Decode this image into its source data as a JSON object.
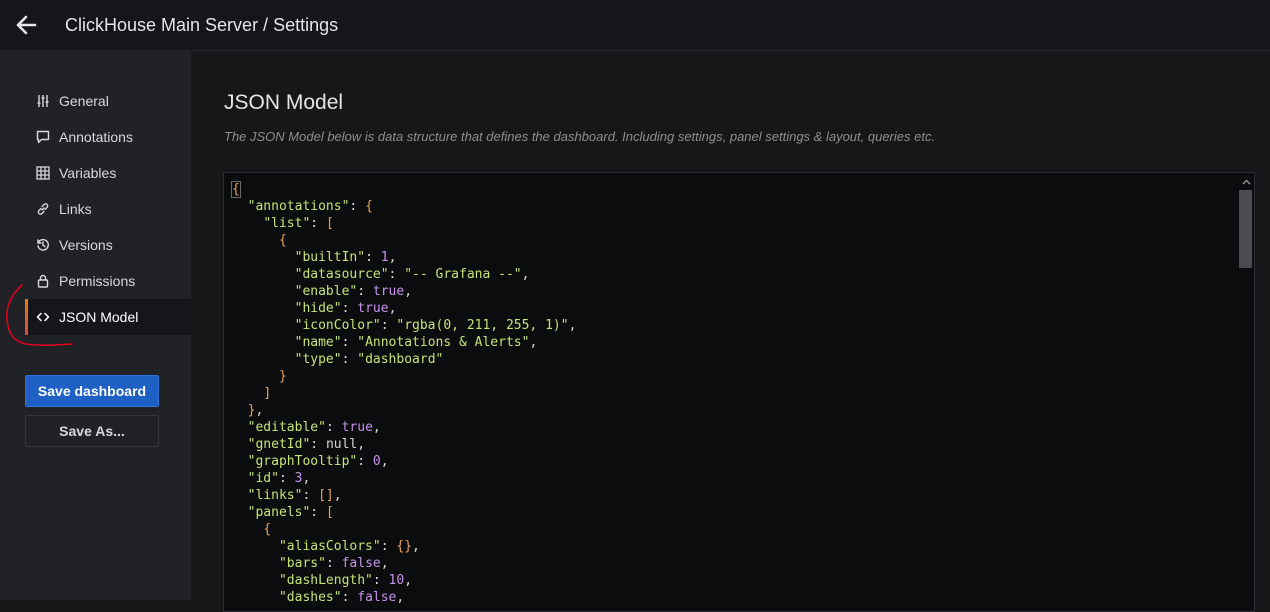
{
  "header": {
    "title": "ClickHouse Main Server / Settings",
    "back_icon": "arrow-left-icon"
  },
  "sidebar": {
    "items": [
      {
        "label": "General",
        "icon": "sliders-icon",
        "active": false
      },
      {
        "label": "Annotations",
        "icon": "comment-icon",
        "active": false
      },
      {
        "label": "Variables",
        "icon": "table-icon",
        "active": false
      },
      {
        "label": "Links",
        "icon": "link-icon",
        "active": false
      },
      {
        "label": "Versions",
        "icon": "history-icon",
        "active": false
      },
      {
        "label": "Permissions",
        "icon": "lock-icon",
        "active": false
      },
      {
        "label": "JSON Model",
        "icon": "code-icon",
        "active": true
      }
    ],
    "save_label": "Save dashboard",
    "save_as_label": "Save As..."
  },
  "main": {
    "title": "JSON Model",
    "description": "The JSON Model below is data structure that defines the dashboard. Including settings, panel settings & layout, queries etc."
  },
  "editor": {
    "lines": [
      {
        "indent": 0,
        "tokens": [
          {
            "t": "{",
            "c": "brk"
          }
        ]
      },
      {
        "indent": 1,
        "tokens": [
          {
            "t": "\"annotations\"",
            "c": "key"
          },
          {
            "t": ": ",
            "c": "pun"
          },
          {
            "t": "{",
            "c": "brk"
          }
        ]
      },
      {
        "indent": 2,
        "tokens": [
          {
            "t": "\"list\"",
            "c": "key"
          },
          {
            "t": ": ",
            "c": "pun"
          },
          {
            "t": "[",
            "c": "brk"
          }
        ]
      },
      {
        "indent": 3,
        "tokens": [
          {
            "t": "{",
            "c": "brk"
          }
        ]
      },
      {
        "indent": 4,
        "tokens": [
          {
            "t": "\"builtIn\"",
            "c": "key"
          },
          {
            "t": ": ",
            "c": "pun"
          },
          {
            "t": "1",
            "c": "num"
          },
          {
            "t": ",",
            "c": "pun"
          }
        ]
      },
      {
        "indent": 4,
        "tokens": [
          {
            "t": "\"datasource\"",
            "c": "key"
          },
          {
            "t": ": ",
            "c": "pun"
          },
          {
            "t": "\"-- Grafana --\"",
            "c": "str"
          },
          {
            "t": ",",
            "c": "pun"
          }
        ]
      },
      {
        "indent": 4,
        "tokens": [
          {
            "t": "\"enable\"",
            "c": "key"
          },
          {
            "t": ": ",
            "c": "pun"
          },
          {
            "t": "true",
            "c": "kw"
          },
          {
            "t": ",",
            "c": "pun"
          }
        ]
      },
      {
        "indent": 4,
        "tokens": [
          {
            "t": "\"hide\"",
            "c": "key"
          },
          {
            "t": ": ",
            "c": "pun"
          },
          {
            "t": "true",
            "c": "kw"
          },
          {
            "t": ",",
            "c": "pun"
          }
        ]
      },
      {
        "indent": 4,
        "tokens": [
          {
            "t": "\"iconColor\"",
            "c": "key"
          },
          {
            "t": ": ",
            "c": "pun"
          },
          {
            "t": "\"rgba(0, 211, 255, 1)\"",
            "c": "str"
          },
          {
            "t": ",",
            "c": "pun"
          }
        ]
      },
      {
        "indent": 4,
        "tokens": [
          {
            "t": "\"name\"",
            "c": "key"
          },
          {
            "t": ": ",
            "c": "pun"
          },
          {
            "t": "\"Annotations & Alerts\"",
            "c": "str"
          },
          {
            "t": ",",
            "c": "pun"
          }
        ]
      },
      {
        "indent": 4,
        "tokens": [
          {
            "t": "\"type\"",
            "c": "key"
          },
          {
            "t": ": ",
            "c": "pun"
          },
          {
            "t": "\"dashboard\"",
            "c": "str"
          }
        ]
      },
      {
        "indent": 3,
        "tokens": [
          {
            "t": "}",
            "c": "brk"
          }
        ]
      },
      {
        "indent": 2,
        "tokens": [
          {
            "t": "]",
            "c": "brk"
          }
        ]
      },
      {
        "indent": 1,
        "tokens": [
          {
            "t": "}",
            "c": "brk"
          },
          {
            "t": ",",
            "c": "pun"
          }
        ]
      },
      {
        "indent": 1,
        "tokens": [
          {
            "t": "\"editable\"",
            "c": "key"
          },
          {
            "t": ": ",
            "c": "pun"
          },
          {
            "t": "true",
            "c": "kw"
          },
          {
            "t": ",",
            "c": "pun"
          }
        ]
      },
      {
        "indent": 1,
        "tokens": [
          {
            "t": "\"gnetId\"",
            "c": "key"
          },
          {
            "t": ": ",
            "c": "pun"
          },
          {
            "t": "null",
            "c": "null"
          },
          {
            "t": ",",
            "c": "pun"
          }
        ]
      },
      {
        "indent": 1,
        "tokens": [
          {
            "t": "\"graphTooltip\"",
            "c": "key"
          },
          {
            "t": ": ",
            "c": "pun"
          },
          {
            "t": "0",
            "c": "num"
          },
          {
            "t": ",",
            "c": "pun"
          }
        ]
      },
      {
        "indent": 1,
        "tokens": [
          {
            "t": "\"id\"",
            "c": "key"
          },
          {
            "t": ": ",
            "c": "pun"
          },
          {
            "t": "3",
            "c": "num"
          },
          {
            "t": ",",
            "c": "pun"
          }
        ]
      },
      {
        "indent": 1,
        "tokens": [
          {
            "t": "\"links\"",
            "c": "key"
          },
          {
            "t": ": ",
            "c": "pun"
          },
          {
            "t": "[]",
            "c": "brk"
          },
          {
            "t": ",",
            "c": "pun"
          }
        ]
      },
      {
        "indent": 1,
        "tokens": [
          {
            "t": "\"panels\"",
            "c": "key"
          },
          {
            "t": ": ",
            "c": "pun"
          },
          {
            "t": "[",
            "c": "brk"
          }
        ]
      },
      {
        "indent": 2,
        "tokens": [
          {
            "t": "{",
            "c": "brk"
          }
        ]
      },
      {
        "indent": 3,
        "tokens": [
          {
            "t": "\"aliasColors\"",
            "c": "key"
          },
          {
            "t": ": ",
            "c": "pun"
          },
          {
            "t": "{}",
            "c": "brk"
          },
          {
            "t": ",",
            "c": "pun"
          }
        ]
      },
      {
        "indent": 3,
        "tokens": [
          {
            "t": "\"bars\"",
            "c": "key"
          },
          {
            "t": ": ",
            "c": "pun"
          },
          {
            "t": "false",
            "c": "kw"
          },
          {
            "t": ",",
            "c": "pun"
          }
        ]
      },
      {
        "indent": 3,
        "tokens": [
          {
            "t": "\"dashLength\"",
            "c": "key"
          },
          {
            "t": ": ",
            "c": "pun"
          },
          {
            "t": "10",
            "c": "num"
          },
          {
            "t": ",",
            "c": "pun"
          }
        ]
      },
      {
        "indent": 3,
        "tokens": [
          {
            "t": "\"dashes\"",
            "c": "key"
          },
          {
            "t": ": ",
            "c": "pun"
          },
          {
            "t": "false",
            "c": "kw"
          },
          {
            "t": ",",
            "c": "pun"
          }
        ]
      }
    ]
  },
  "colors": {
    "accent": "#1f60c4",
    "active_bar": "#eb7b18",
    "annotation": "#e0001b"
  }
}
